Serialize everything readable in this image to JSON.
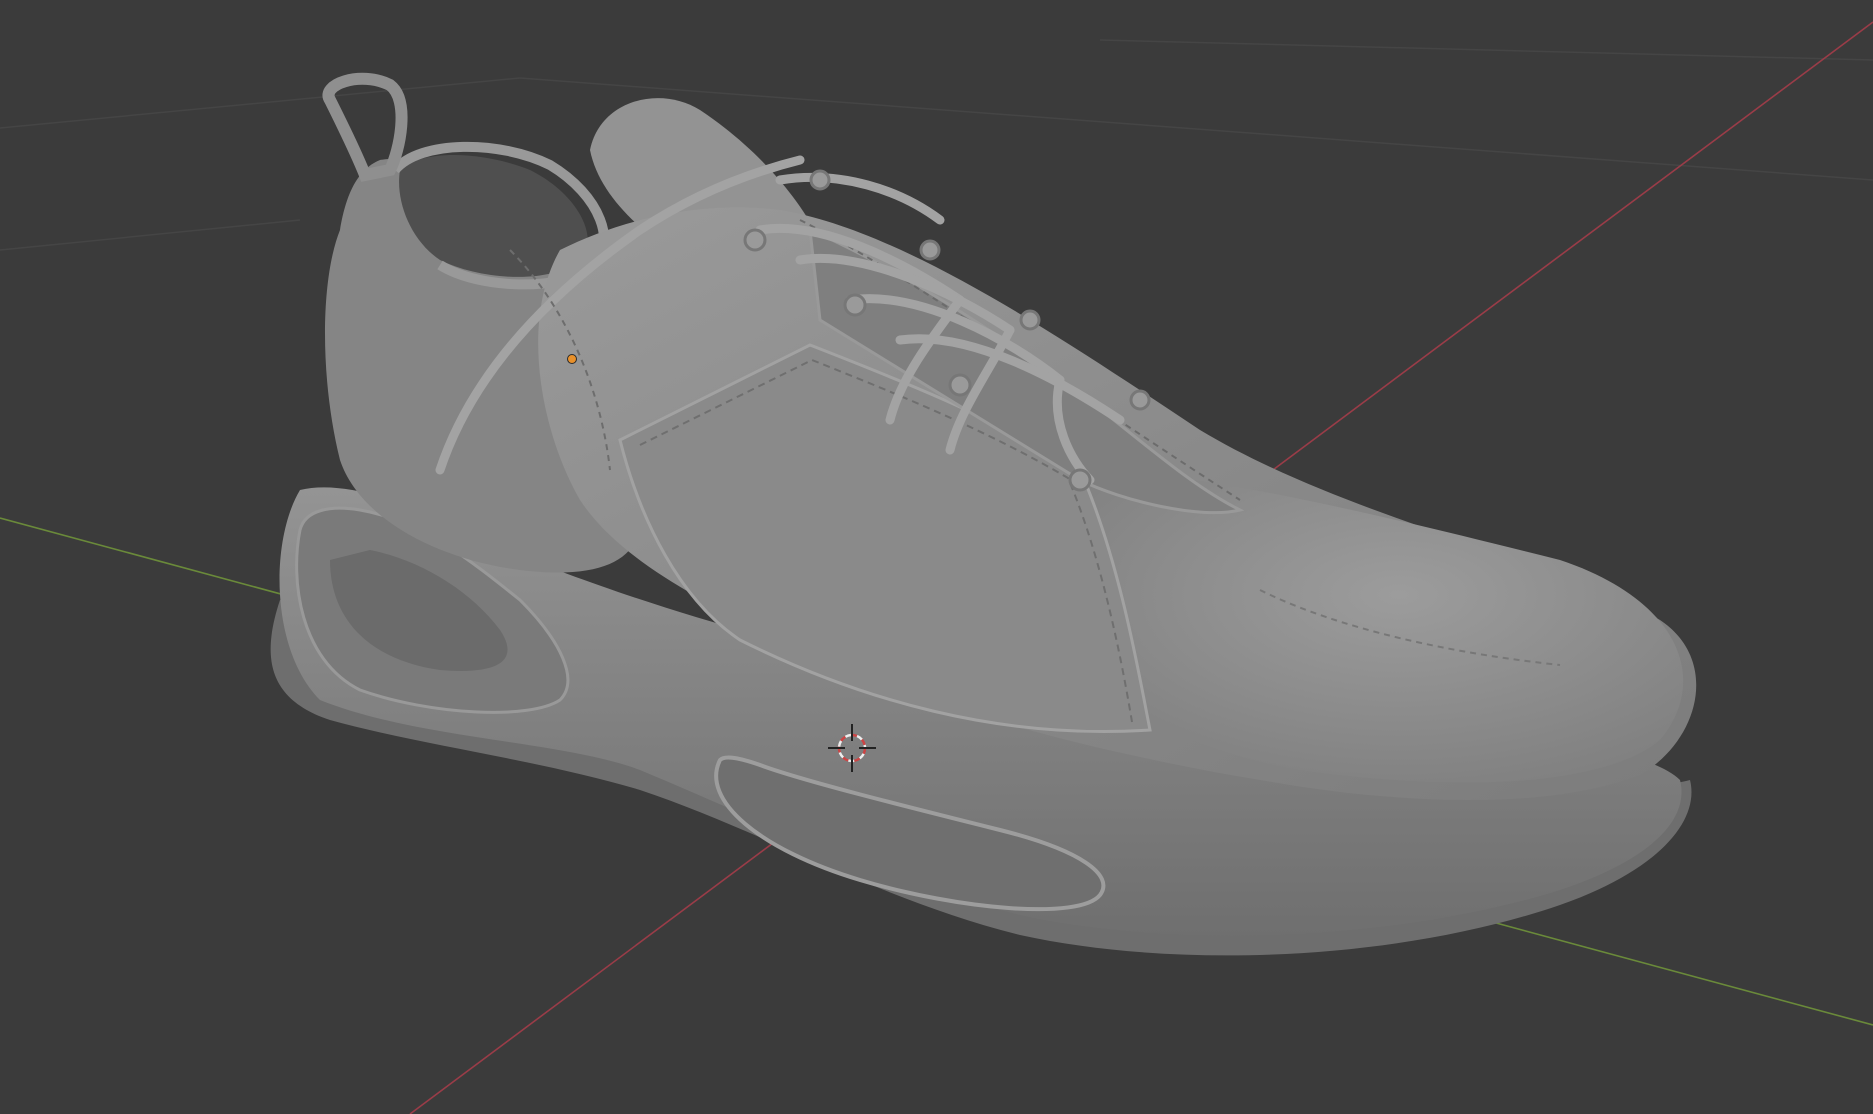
{
  "viewport": {
    "background": "#3b3b3b",
    "grid_color": "#454545",
    "x_axis_color": "#9a3c48",
    "y_axis_color": "#6a8a3a",
    "model_color": "#8c8c8c",
    "origin_point_color": "#e8902a",
    "object": "sneaker-mesh",
    "icons": [
      "3d-cursor-icon",
      "origin-point-icon"
    ]
  }
}
